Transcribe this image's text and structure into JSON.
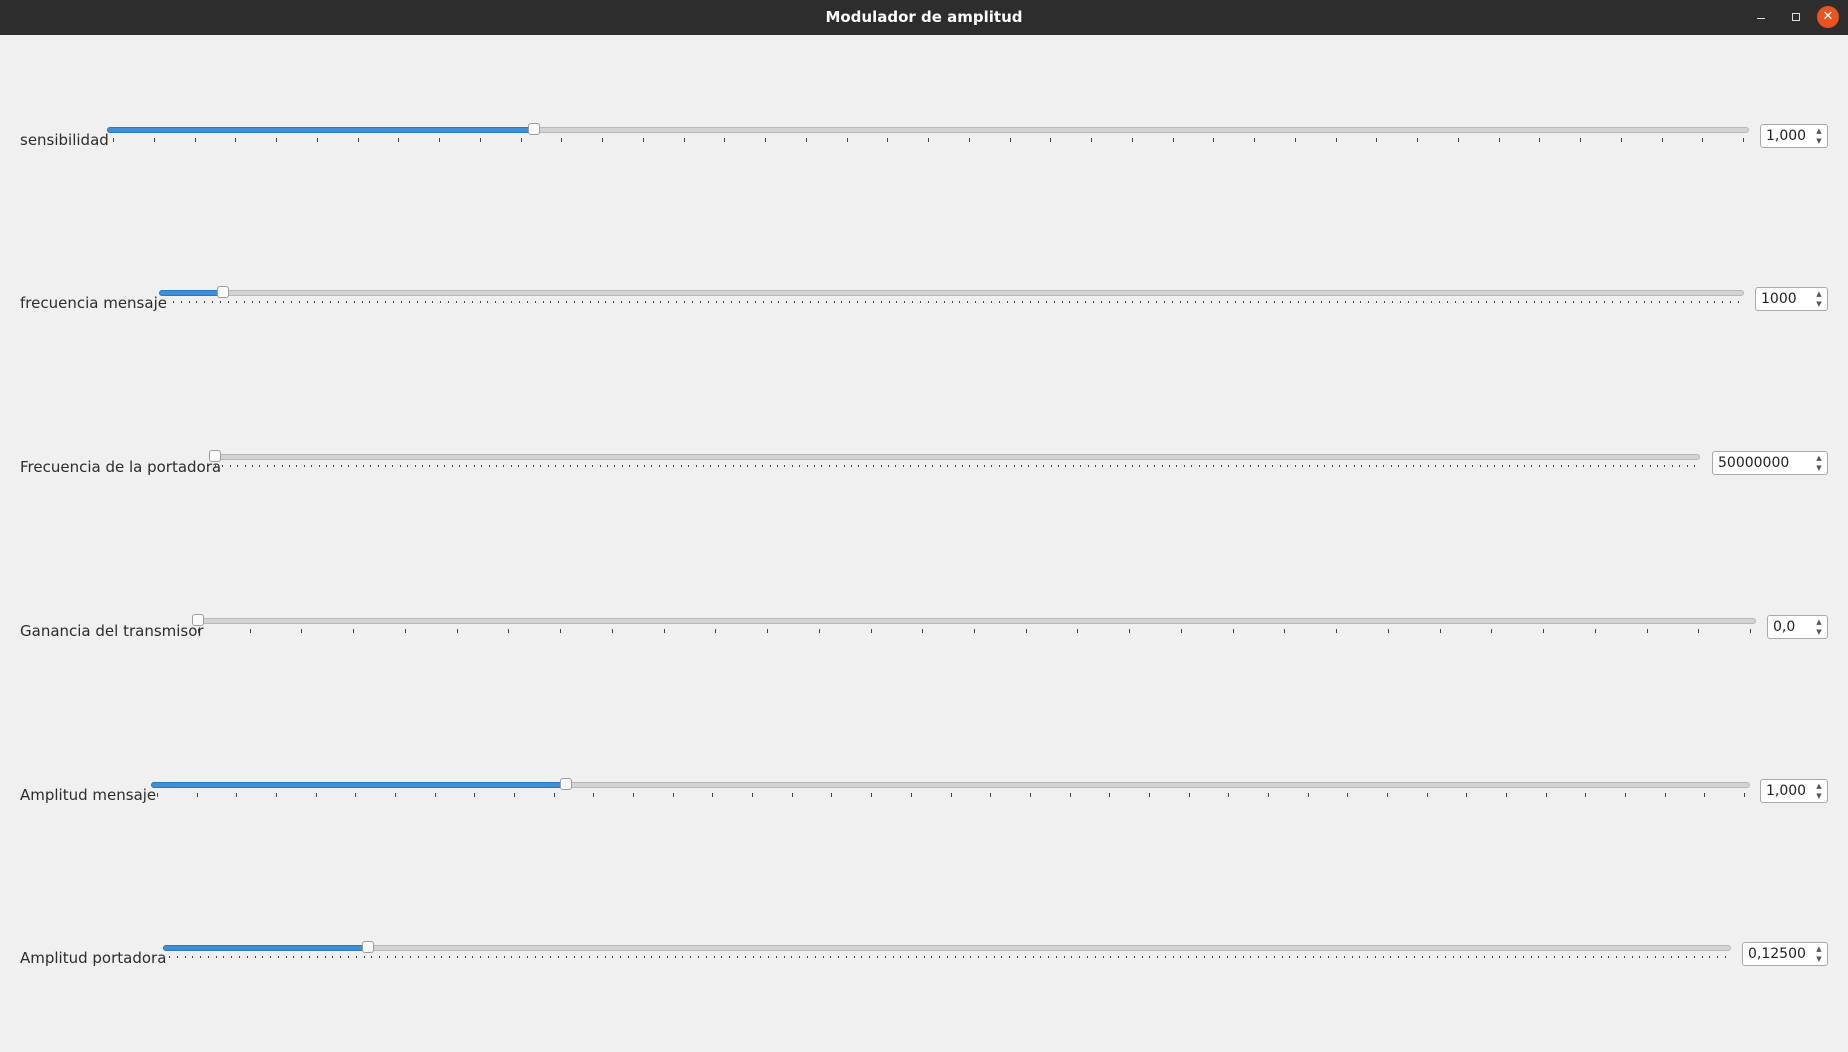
{
  "window": {
    "title": "Modulador de amplitud",
    "controls": {
      "minimize": "–",
      "maximize": "▢",
      "close": "✕"
    }
  },
  "icons": {
    "spin_up": "▲",
    "spin_down": "▼"
  },
  "colors": {
    "accent": "#3d8fd6",
    "titlebar": "#2e2d2d",
    "close": "#e95420",
    "background": "#f0f0f0"
  },
  "controls": [
    {
      "label": "sensibilidad",
      "value": "1,000",
      "position": 0.258,
      "ticks": 40
    },
    {
      "label": "frecuencia mensaje",
      "value": "1000",
      "position": 0.037,
      "ticks": 200
    },
    {
      "label": "Frecuencia de la portadora",
      "value": "50000000",
      "position": 0.0,
      "ticks": 200
    },
    {
      "label": "Ganancia del transmisor",
      "value": "0,0",
      "position": 0.0,
      "ticks": 30
    },
    {
      "label": "Amplitud mensaje",
      "value": "1,000",
      "position": 0.258,
      "ticks": 40
    },
    {
      "label": "Amplitud portadora",
      "value": "0,12500",
      "position": 0.128,
      "ticks": 200
    }
  ]
}
